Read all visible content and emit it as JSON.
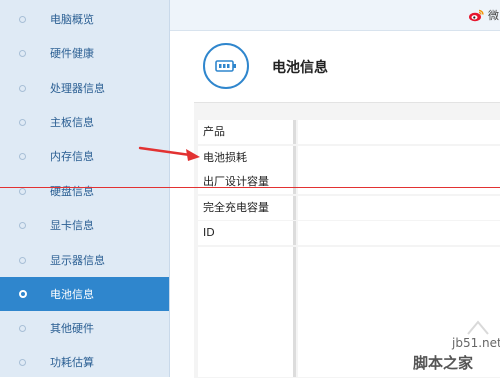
{
  "sidebar": {
    "items": [
      {
        "label": "电脑概览",
        "active": false
      },
      {
        "label": "硬件健康",
        "active": false
      },
      {
        "label": "处理器信息",
        "active": false
      },
      {
        "label": "主板信息",
        "active": false
      },
      {
        "label": "内存信息",
        "active": false
      },
      {
        "label": "硬盘信息",
        "active": false
      },
      {
        "label": "显卡信息",
        "active": false
      },
      {
        "label": "显示器信息",
        "active": false
      },
      {
        "label": "电池信息",
        "active": true
      },
      {
        "label": "其他硬件",
        "active": false
      },
      {
        "label": "功耗估算",
        "active": false
      }
    ]
  },
  "topbar": {
    "weibo_label": "微"
  },
  "header": {
    "title": "电池信息",
    "icon": "battery-icon"
  },
  "table": {
    "rows": [
      {
        "label": "产品",
        "value": ""
      },
      {
        "label": "电池损耗",
        "value": ""
      },
      {
        "label": "出厂设计容量",
        "value": ""
      },
      {
        "label": "完全充电容量",
        "value": ""
      },
      {
        "label": "ID",
        "value": ""
      }
    ]
  },
  "watermark": {
    "url": "jb51.net",
    "text": "脚本之家"
  },
  "colors": {
    "accent": "#2f86cd",
    "sidebar_bg": "#dfeaf5",
    "annotation": "#e23232"
  }
}
